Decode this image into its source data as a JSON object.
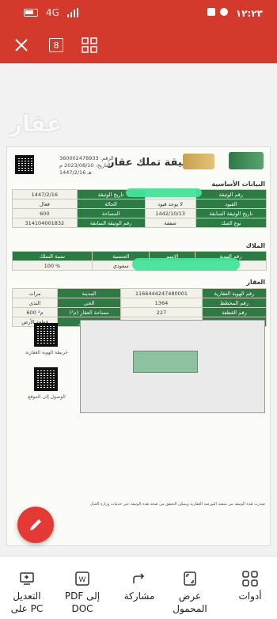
{
  "status_bar": {
    "time": "١٢:٢٣",
    "signal_text": "4G",
    "network_icon": "signal-icon",
    "battery_icon": "battery-icon"
  },
  "toolbar": {
    "close_icon": "close-icon",
    "page_number": "8",
    "grid_icon": "grid-icon"
  },
  "document": {
    "watermark": "عقار",
    "title": "وثيقة تملك عقار",
    "meta_number": "الرقم: 360002478933",
    "meta_date": "التاريخ: 2023/08/10 م",
    "meta_hijri": "1447/2/16 هـ",
    "basic_section": "البيانات الأساسية",
    "basic_rows": [
      {
        "l1": "رقم الوثيقة",
        "v1": "",
        "l2": "تاريخ الوثيقة",
        "v2": "1447/2/16"
      },
      {
        "l1": "القيود",
        "v1": "لا يوجد قيود",
        "l2": "الحالة",
        "v2": "فعال"
      },
      {
        "l1": "تاريخ الوثيقة السابقة",
        "v1": "1442/10/13",
        "l2": "المساحة",
        "v2": "600"
      },
      {
        "l1": "نوع الصك",
        "v1": "صفقة",
        "l2": "رقم الوثيقة السابقة",
        "v2": "314104001832"
      }
    ],
    "owners_section": "الملاك",
    "owners_headers": [
      "رقم الهوية",
      "الاسم",
      "الجنسية",
      "نسبة التملك"
    ],
    "owners_row": [
      "",
      "",
      "سعودي",
      "100 %"
    ],
    "property_section": "العقار",
    "property_rows": [
      {
        "l1": "رقم الهوية العقارية",
        "v1": "1166444247480001",
        "l2": "المدينة",
        "v2": "مرات"
      },
      {
        "l1": "رقم المخطط",
        "v1": "1364",
        "l2": "الحي",
        "v2": "الندى"
      },
      {
        "l1": "رقم القطعة",
        "v1": "227",
        "l2": "مساحة العقار (م²)",
        "v2": "600 م²"
      },
      {
        "l1": "نوع المخطط",
        "v1": "مخطط",
        "l2": "نوع العقار",
        "v2": "قطعة الأرض"
      }
    ],
    "qr_label_1": "خريطة الهوية العقارية",
    "qr_label_2": "الوصول إلى الموقع",
    "footer_note": "صدرت هذه الوثيقة من منصة البورصة العقارية ويمكن التحقق من صحة هذه الوثيقة عبر خدمات وزارة العدل"
  },
  "bottom_bar": {
    "items": [
      {
        "label": "أدوات",
        "icon": "tools-grid-icon"
      },
      {
        "label": "عرض المحمول",
        "icon": "mobile-view-icon"
      },
      {
        "label": "مشاركة",
        "icon": "share-icon"
      },
      {
        "label": "PDF إلى DOC",
        "icon": "word-doc-icon"
      },
      {
        "label": "التعديل على PC",
        "icon": "pc-edit-icon"
      }
    ]
  },
  "colors": {
    "brand_red": "#d33a2c",
    "table_green": "#2d7a45",
    "highlight_green": "#44e39a",
    "fab_red": "#e53935"
  }
}
